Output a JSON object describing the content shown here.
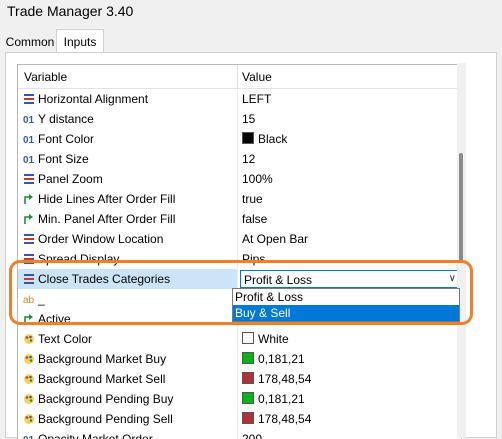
{
  "window": {
    "title": "Trade Manager 3.40"
  },
  "tabs": [
    {
      "label": "Common"
    },
    {
      "label": "Inputs"
    }
  ],
  "grid": {
    "col_variable": "Variable",
    "col_value": "Value",
    "rows": [
      {
        "label": "Horizontal Alignment",
        "value": "LEFT",
        "icon": "enum-list-icon"
      },
      {
        "label": "Y distance",
        "value": "15",
        "icon": "integer-01-icon"
      },
      {
        "label": "Font Color",
        "value": "Black",
        "icon": "integer-01-icon",
        "color": "#000000"
      },
      {
        "label": "Font Size",
        "value": "12",
        "icon": "integer-01-icon"
      },
      {
        "label": "Panel Zoom",
        "value": "100%",
        "icon": "enum-list-icon"
      },
      {
        "label": "Hide Lines After Order Fill",
        "value": "true",
        "icon": "bool-arrow-icon"
      },
      {
        "label": "Min. Panel After Order Fill",
        "value": "false",
        "icon": "bool-arrow-icon"
      },
      {
        "label": "Order Window Location",
        "value": "At Open Bar",
        "icon": "enum-list-icon"
      },
      {
        "label": "Spread Display",
        "value": "Pips",
        "icon": "enum-list-icon"
      },
      {
        "label": "Close Trades Categories",
        "value": "Profit & Loss",
        "icon": "enum-list-icon"
      },
      {
        "label": "_",
        "value": "",
        "icon": "string-ab-icon"
      },
      {
        "label": "Active",
        "value": "true",
        "icon": "bool-arrow-icon"
      },
      {
        "label": "Text Color",
        "value": "White",
        "icon": "color-palette-icon",
        "color": "#ffffff"
      },
      {
        "label": "Background Market Buy",
        "value": "0,181,21",
        "icon": "color-palette-icon",
        "color": "#00b515"
      },
      {
        "label": "Background Market Sell",
        "value": "178,48,54",
        "icon": "color-palette-icon",
        "color": "#b23036"
      },
      {
        "label": "Background Pending Buy",
        "value": "0,181,21",
        "icon": "color-palette-icon",
        "color": "#00b515"
      },
      {
        "label": "Background Pending Sell",
        "value": "178,48,54",
        "icon": "color-palette-icon",
        "color": "#b23036"
      },
      {
        "label": "Opacity Market Order",
        "value": "200",
        "icon": "integer-01-icon"
      }
    ]
  },
  "dropdown": {
    "options": [
      "Profit & Loss",
      "Buy & Sell"
    ],
    "highlighted": "Buy & Sell"
  },
  "colors": {
    "accent": "#0078d7",
    "callout": "#f07f27",
    "selection": "#cce4f7"
  }
}
